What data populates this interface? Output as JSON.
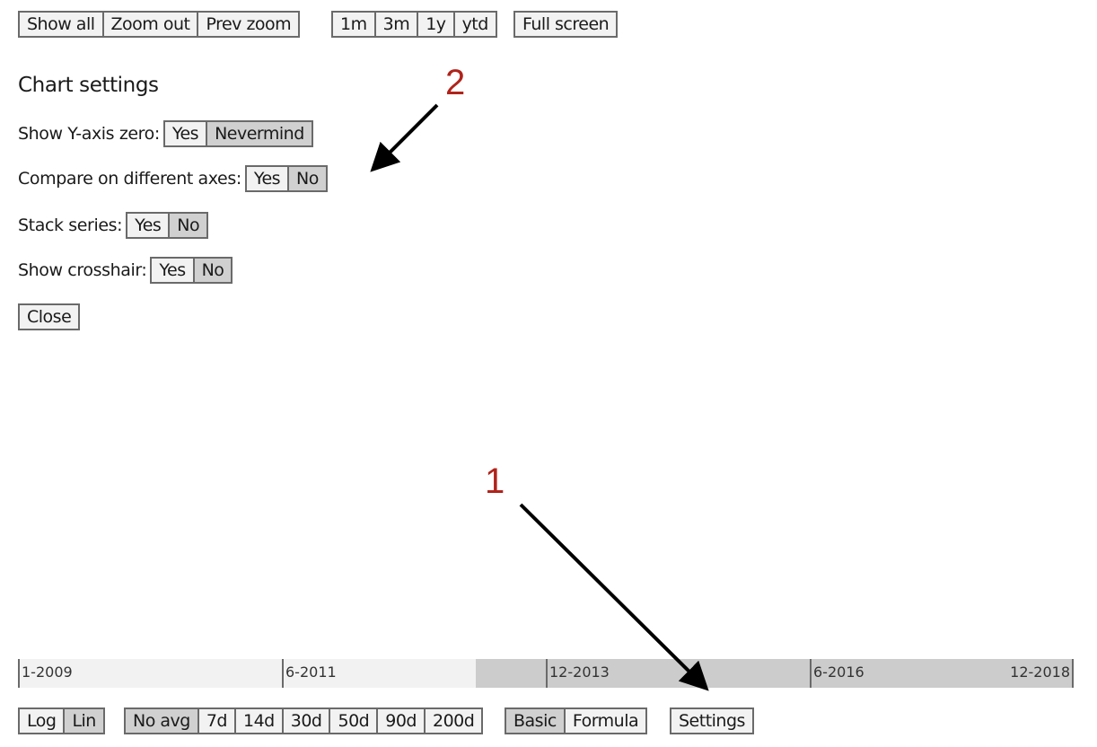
{
  "toolbar": {
    "zoom_group": [
      "Show all",
      "Zoom out",
      "Prev zoom"
    ],
    "range_group": [
      "1m",
      "3m",
      "1y",
      "ytd"
    ],
    "fullscreen": "Full screen"
  },
  "settings": {
    "title": "Chart settings",
    "rows": [
      {
        "label": "Show Y-axis zero:",
        "options": [
          "Yes",
          "Nevermind"
        ],
        "active": "Nevermind"
      },
      {
        "label": "Compare on different axes:",
        "options": [
          "Yes",
          "No"
        ],
        "active": "No"
      },
      {
        "label": "Stack series:",
        "options": [
          "Yes",
          "No"
        ],
        "active": "No"
      },
      {
        "label": "Show crosshair:",
        "options": [
          "Yes",
          "No"
        ],
        "active": "No"
      }
    ],
    "close": "Close"
  },
  "timeline": {
    "ticks": [
      "1-2009",
      "6-2011",
      "12-2013",
      "6-2016",
      "12-2018"
    ]
  },
  "bottom": {
    "scale_group": [
      "Log",
      "Lin"
    ],
    "scale_active": "Lin",
    "avg_group": [
      "No avg",
      "7d",
      "14d",
      "30d",
      "50d",
      "90d",
      "200d"
    ],
    "avg_active": "No avg",
    "mode_group": [
      "Basic",
      "Formula"
    ],
    "mode_active": "Basic",
    "settings": "Settings"
  },
  "annotations": {
    "label_1": "1",
    "label_2": "2",
    "color": "#b0231b"
  }
}
